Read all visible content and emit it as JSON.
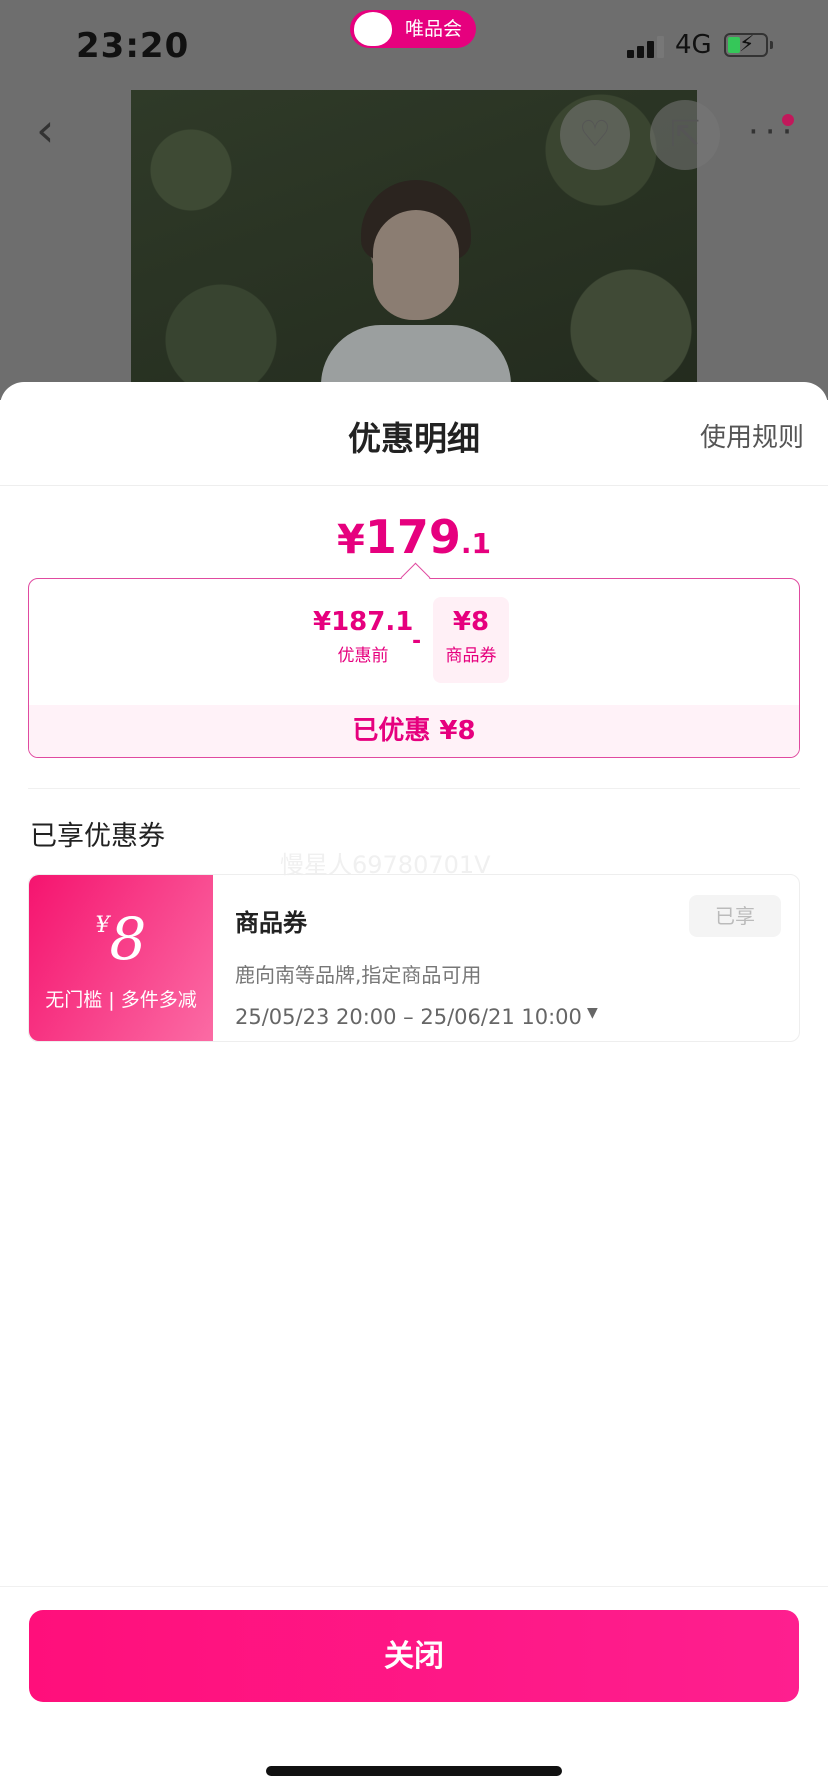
{
  "status_bar": {
    "time": "23:20",
    "app_name": "唯品会",
    "network": "4G"
  },
  "nav": {
    "back_glyph": "‹",
    "fav_glyph": "♡",
    "share_glyph": "⇱",
    "more_glyph": "···"
  },
  "sheet": {
    "title": "优惠明细",
    "rules_link": "使用规则",
    "final_price": {
      "currency": "¥",
      "integer": "179",
      "decimal": ".1"
    },
    "calc": {
      "before_value": "¥187.1",
      "before_label": "优惠前",
      "operator": "-",
      "coupon_value": "¥8",
      "coupon_label": "商品券",
      "saved_text": "已优惠 ¥8"
    },
    "section_title": "已享优惠券",
    "watermark": "慢星人69780701V",
    "coupon": {
      "currency": "¥",
      "amount": "8",
      "condition": "无门槛 | 多件多减",
      "name": "商品券",
      "status": "已享",
      "scope": "鹿向南等品牌,指定商品可用",
      "validity": "25/05/23 20:00 – 25/06/21 10:00",
      "expand_icon": "▼"
    },
    "close_button": "关闭"
  },
  "colors": {
    "accent": "#e6007e",
    "button": "#ff0f7b"
  }
}
